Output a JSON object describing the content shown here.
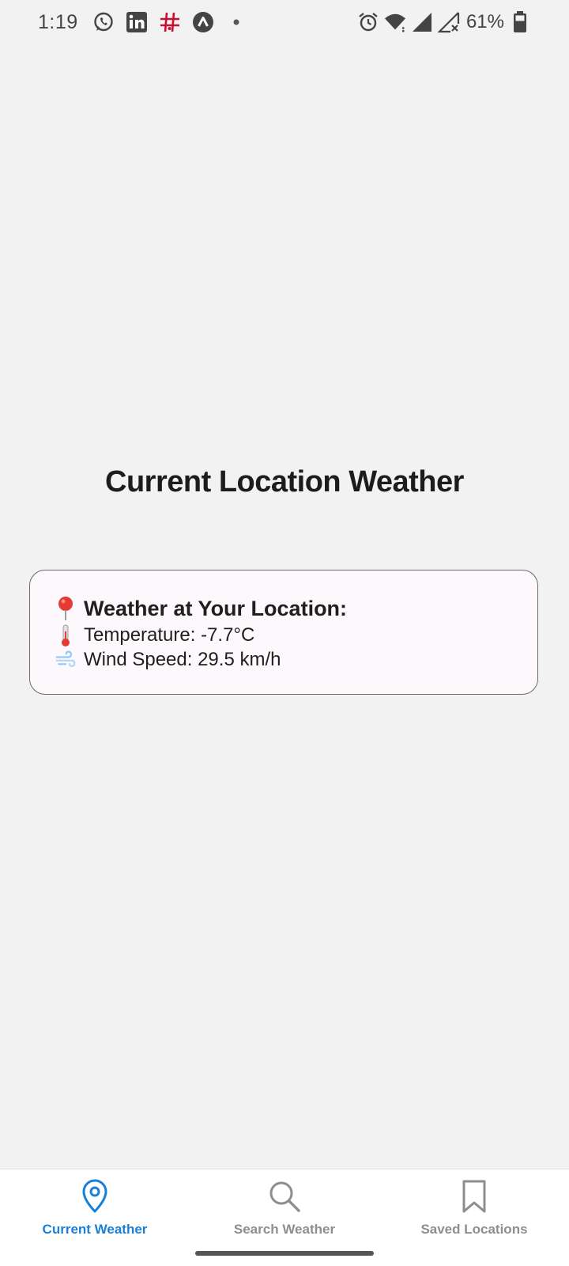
{
  "status_bar": {
    "time": "1:19",
    "left_icons": [
      "whatsapp-icon",
      "linkedin-icon",
      "hashtag-icon",
      "app-a-icon",
      "dot-icon"
    ],
    "right_icons": [
      "alarm-icon",
      "wifi-icon",
      "signal-icon",
      "signal-no-service-icon"
    ],
    "battery_percent": "61%"
  },
  "main": {
    "title": "Current Location Weather",
    "card": {
      "heading_icon": "pin-icon",
      "heading": "Weather at Your Location:",
      "temperature_icon": "thermometer-icon",
      "temperature": "Temperature: -7.7°C",
      "wind_icon": "wind-icon",
      "wind": "Wind Speed: 29.5 km/h"
    }
  },
  "bottom_nav": {
    "items": [
      {
        "label": "Current Weather",
        "icon": "location-pin-icon",
        "active": true
      },
      {
        "label": "Search Weather",
        "icon": "search-icon",
        "active": false
      },
      {
        "label": "Saved Locations",
        "icon": "bookmark-icon",
        "active": false
      }
    ],
    "active_color": "#1a7fd6",
    "inactive_color": "#8e8e8e"
  }
}
